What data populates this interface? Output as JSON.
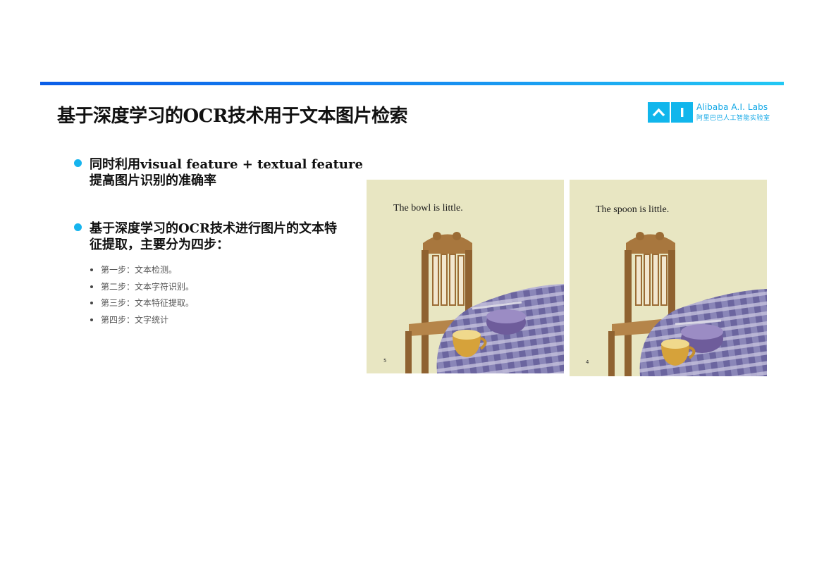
{
  "slide": {
    "title": "基于深度学习的OCR技术用于文本图片检索",
    "logo": {
      "brand": "Alibaba A.I. Labs",
      "brand_cn": "阿里巴巴人工智能实验室",
      "icon_name": "ai-logo-icon",
      "accent_color": "#11b6ec"
    },
    "points": [
      {
        "line1": "同时利用visual feature + textual feature",
        "line2": "提高图片识别的准确率"
      },
      {
        "line1": "基于深度学习的OCR技术进行图片的文本特",
        "line2": "征提取，主要分为四步："
      }
    ],
    "steps": [
      "第一步：文本检测。",
      "第二步：文本字符识别。",
      "第三步：文本特征提取。",
      "第四步：文字统计"
    ],
    "images": [
      {
        "caption": "The bowl  is  little.",
        "page_number": "5"
      },
      {
        "caption": "The  spoon  is  little.",
        "page_number": "4"
      }
    ]
  }
}
